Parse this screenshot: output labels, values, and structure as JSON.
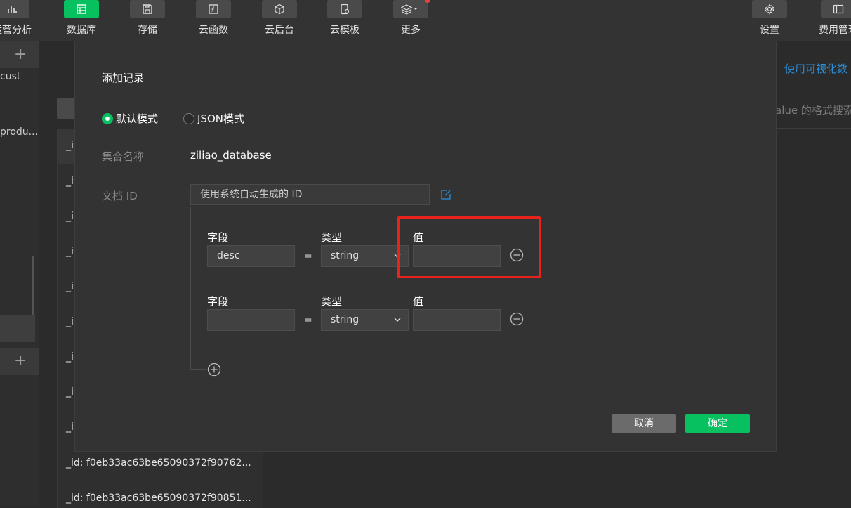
{
  "toolbar": {
    "items": [
      {
        "label": "运营分析",
        "icon": "bar-chart-icon"
      },
      {
        "label": "数据库",
        "icon": "database-icon"
      },
      {
        "label": "存储",
        "icon": "save-icon"
      },
      {
        "label": "云函数",
        "icon": "function-icon"
      },
      {
        "label": "云后台",
        "icon": "cube-icon"
      },
      {
        "label": "云模板",
        "icon": "template-icon"
      },
      {
        "label": "更多",
        "icon": "layers-icon"
      },
      {
        "label": "设置",
        "icon": "gear-icon"
      },
      {
        "label": "费用管理",
        "icon": "billing-icon"
      }
    ],
    "accent": "#07c160"
  },
  "sidebar": {
    "items": [
      "cust",
      "produ..."
    ]
  },
  "background": {
    "list_rows": [
      "_i",
      "_i",
      "_i",
      "_i",
      "_i",
      "_i",
      "_i",
      "_i",
      "_i",
      "_id: f0eb33ac63be65090372f90762...",
      "_id: f0eb33ac63be65090372f90851..."
    ],
    "visual_link": "使用可视化数",
    "search_placeholder": "alue 的格式搜索"
  },
  "modal": {
    "title": "添加记录",
    "mode_default": "默认模式",
    "mode_json": "JSON模式",
    "collection_label": "集合名称",
    "collection_value": "ziliao_database",
    "docid_label": "文档 ID",
    "docid_placeholder": "使用系统自动生成的 ID",
    "rows": [
      {
        "field_label": "字段",
        "type_label": "类型",
        "value_label": "值",
        "field_value": "desc",
        "type_value": "string",
        "value_value": "",
        "eq": "="
      },
      {
        "field_label": "字段",
        "type_label": "类型",
        "value_label": "值",
        "field_value": "",
        "type_value": "string",
        "value_value": "",
        "eq": "="
      }
    ],
    "cancel_label": "取消",
    "confirm_label": "确定",
    "highlight_color": "#e8231b"
  }
}
